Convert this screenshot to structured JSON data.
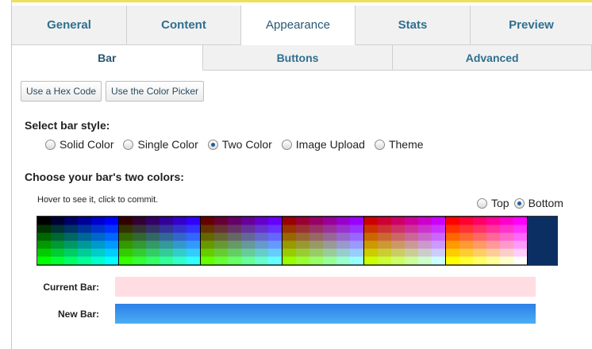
{
  "tabs": [
    {
      "label": "General",
      "active": false
    },
    {
      "label": "Content",
      "active": false
    },
    {
      "label": "Appearance",
      "active": true
    },
    {
      "label": "Stats",
      "active": false
    },
    {
      "label": "Preview",
      "active": false
    }
  ],
  "subtabs": [
    {
      "label": "Bar",
      "active": true
    },
    {
      "label": "Buttons",
      "active": false
    },
    {
      "label": "Advanced",
      "active": false
    }
  ],
  "buttons": {
    "hex": "Use a Hex Code",
    "picker": "Use the Color Picker"
  },
  "bar_style": {
    "heading": "Select bar style:",
    "options": [
      {
        "label": "Solid Color",
        "checked": false
      },
      {
        "label": "Single Color",
        "checked": false
      },
      {
        "label": "Two Color",
        "checked": true
      },
      {
        "label": "Image Upload",
        "checked": false
      },
      {
        "label": "Theme",
        "checked": false
      }
    ]
  },
  "two_colors": {
    "heading": "Choose your bar's two colors:",
    "hint": "Hover to see it, click to commit.",
    "position_options": [
      {
        "label": "Top",
        "checked": false
      },
      {
        "label": "Bottom",
        "checked": true
      }
    ]
  },
  "swatches": {
    "current_label": "Current Bar:",
    "new_label": "New Bar:",
    "current_color": "#ffdde3",
    "new_gradient": [
      "#2d7fe6",
      "#4aaef5"
    ]
  },
  "palette": {
    "selected_color": "#0b2f63"
  }
}
